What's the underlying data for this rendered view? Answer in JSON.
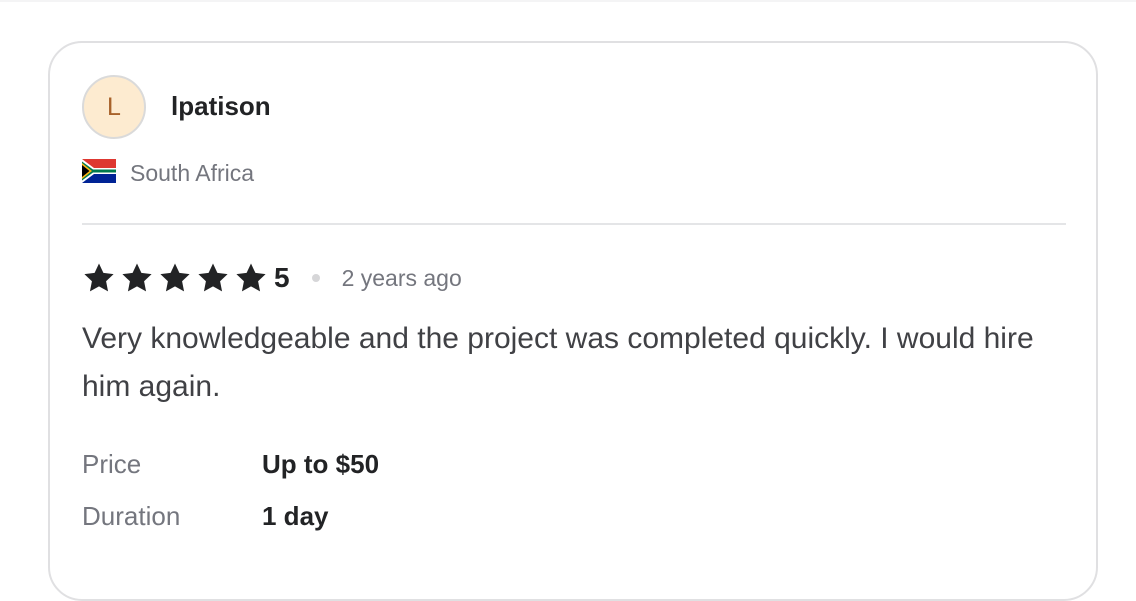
{
  "reviewer": {
    "initial": "L",
    "username": "lpatison",
    "country": "South Africa",
    "flag_icon": "south-africa-flag-icon"
  },
  "review": {
    "rating": "5",
    "stars": 5,
    "time_ago": "2 years ago",
    "text": "Very knowledgeable and the project was completed quickly. I would hire him again."
  },
  "details": {
    "price_label": "Price",
    "price_value": "Up to $50",
    "duration_label": "Duration",
    "duration_value": "1 day"
  },
  "colors": {
    "star": "#222325",
    "avatar_bg": "#fdebd0",
    "avatar_text": "#a8622a"
  }
}
